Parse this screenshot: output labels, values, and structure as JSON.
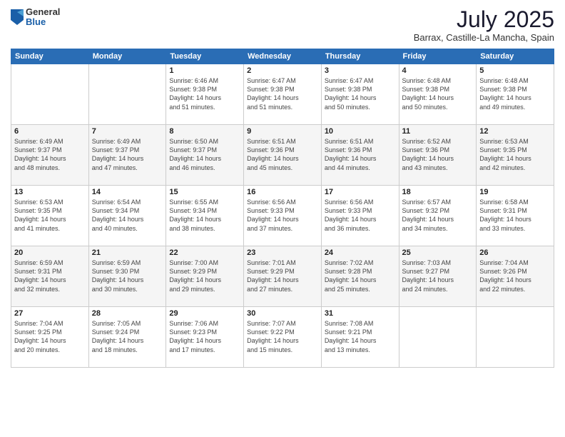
{
  "header": {
    "logo_general": "General",
    "logo_blue": "Blue",
    "month_title": "July 2025",
    "location": "Barrax, Castille-La Mancha, Spain"
  },
  "weekdays": [
    "Sunday",
    "Monday",
    "Tuesday",
    "Wednesday",
    "Thursday",
    "Friday",
    "Saturday"
  ],
  "weeks": [
    [
      {
        "day": "",
        "info": ""
      },
      {
        "day": "",
        "info": ""
      },
      {
        "day": "1",
        "info": "Sunrise: 6:46 AM\nSunset: 9:38 PM\nDaylight: 14 hours\nand 51 minutes."
      },
      {
        "day": "2",
        "info": "Sunrise: 6:47 AM\nSunset: 9:38 PM\nDaylight: 14 hours\nand 51 minutes."
      },
      {
        "day": "3",
        "info": "Sunrise: 6:47 AM\nSunset: 9:38 PM\nDaylight: 14 hours\nand 50 minutes."
      },
      {
        "day": "4",
        "info": "Sunrise: 6:48 AM\nSunset: 9:38 PM\nDaylight: 14 hours\nand 50 minutes."
      },
      {
        "day": "5",
        "info": "Sunrise: 6:48 AM\nSunset: 9:38 PM\nDaylight: 14 hours\nand 49 minutes."
      }
    ],
    [
      {
        "day": "6",
        "info": "Sunrise: 6:49 AM\nSunset: 9:37 PM\nDaylight: 14 hours\nand 48 minutes."
      },
      {
        "day": "7",
        "info": "Sunrise: 6:49 AM\nSunset: 9:37 PM\nDaylight: 14 hours\nand 47 minutes."
      },
      {
        "day": "8",
        "info": "Sunrise: 6:50 AM\nSunset: 9:37 PM\nDaylight: 14 hours\nand 46 minutes."
      },
      {
        "day": "9",
        "info": "Sunrise: 6:51 AM\nSunset: 9:36 PM\nDaylight: 14 hours\nand 45 minutes."
      },
      {
        "day": "10",
        "info": "Sunrise: 6:51 AM\nSunset: 9:36 PM\nDaylight: 14 hours\nand 44 minutes."
      },
      {
        "day": "11",
        "info": "Sunrise: 6:52 AM\nSunset: 9:36 PM\nDaylight: 14 hours\nand 43 minutes."
      },
      {
        "day": "12",
        "info": "Sunrise: 6:53 AM\nSunset: 9:35 PM\nDaylight: 14 hours\nand 42 minutes."
      }
    ],
    [
      {
        "day": "13",
        "info": "Sunrise: 6:53 AM\nSunset: 9:35 PM\nDaylight: 14 hours\nand 41 minutes."
      },
      {
        "day": "14",
        "info": "Sunrise: 6:54 AM\nSunset: 9:34 PM\nDaylight: 14 hours\nand 40 minutes."
      },
      {
        "day": "15",
        "info": "Sunrise: 6:55 AM\nSunset: 9:34 PM\nDaylight: 14 hours\nand 38 minutes."
      },
      {
        "day": "16",
        "info": "Sunrise: 6:56 AM\nSunset: 9:33 PM\nDaylight: 14 hours\nand 37 minutes."
      },
      {
        "day": "17",
        "info": "Sunrise: 6:56 AM\nSunset: 9:33 PM\nDaylight: 14 hours\nand 36 minutes."
      },
      {
        "day": "18",
        "info": "Sunrise: 6:57 AM\nSunset: 9:32 PM\nDaylight: 14 hours\nand 34 minutes."
      },
      {
        "day": "19",
        "info": "Sunrise: 6:58 AM\nSunset: 9:31 PM\nDaylight: 14 hours\nand 33 minutes."
      }
    ],
    [
      {
        "day": "20",
        "info": "Sunrise: 6:59 AM\nSunset: 9:31 PM\nDaylight: 14 hours\nand 32 minutes."
      },
      {
        "day": "21",
        "info": "Sunrise: 6:59 AM\nSunset: 9:30 PM\nDaylight: 14 hours\nand 30 minutes."
      },
      {
        "day": "22",
        "info": "Sunrise: 7:00 AM\nSunset: 9:29 PM\nDaylight: 14 hours\nand 29 minutes."
      },
      {
        "day": "23",
        "info": "Sunrise: 7:01 AM\nSunset: 9:29 PM\nDaylight: 14 hours\nand 27 minutes."
      },
      {
        "day": "24",
        "info": "Sunrise: 7:02 AM\nSunset: 9:28 PM\nDaylight: 14 hours\nand 25 minutes."
      },
      {
        "day": "25",
        "info": "Sunrise: 7:03 AM\nSunset: 9:27 PM\nDaylight: 14 hours\nand 24 minutes."
      },
      {
        "day": "26",
        "info": "Sunrise: 7:04 AM\nSunset: 9:26 PM\nDaylight: 14 hours\nand 22 minutes."
      }
    ],
    [
      {
        "day": "27",
        "info": "Sunrise: 7:04 AM\nSunset: 9:25 PM\nDaylight: 14 hours\nand 20 minutes."
      },
      {
        "day": "28",
        "info": "Sunrise: 7:05 AM\nSunset: 9:24 PM\nDaylight: 14 hours\nand 18 minutes."
      },
      {
        "day": "29",
        "info": "Sunrise: 7:06 AM\nSunset: 9:23 PM\nDaylight: 14 hours\nand 17 minutes."
      },
      {
        "day": "30",
        "info": "Sunrise: 7:07 AM\nSunset: 9:22 PM\nDaylight: 14 hours\nand 15 minutes."
      },
      {
        "day": "31",
        "info": "Sunrise: 7:08 AM\nSunset: 9:21 PM\nDaylight: 14 hours\nand 13 minutes."
      },
      {
        "day": "",
        "info": ""
      },
      {
        "day": "",
        "info": ""
      }
    ]
  ]
}
